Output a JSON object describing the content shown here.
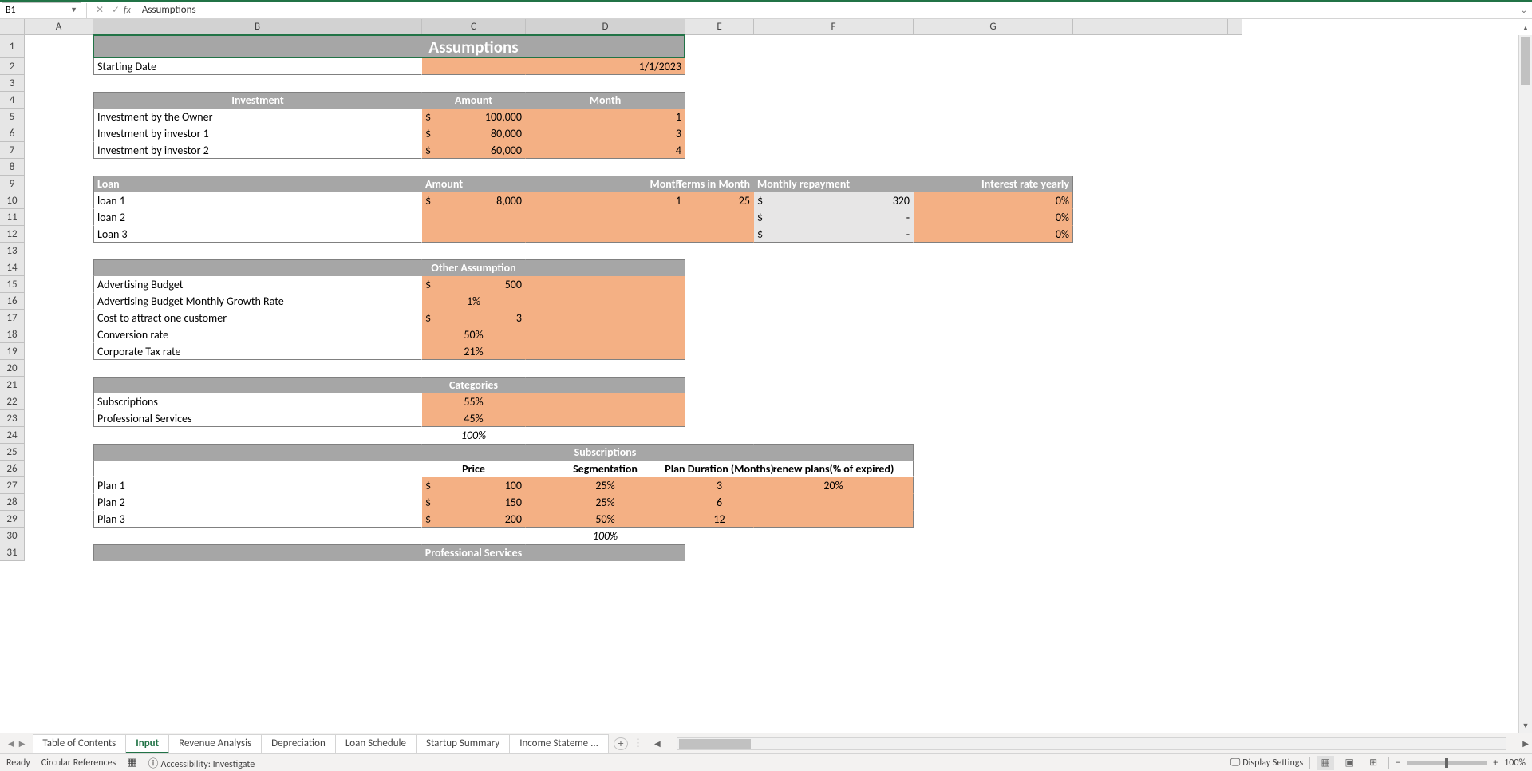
{
  "nameBox": "B1",
  "formulaBar": "Assumptions",
  "columns": [
    "A",
    "B",
    "C",
    "D",
    "E",
    "F",
    "G"
  ],
  "rows": [
    "1",
    "2",
    "3",
    "4",
    "5",
    "6",
    "7",
    "8",
    "9",
    "10",
    "11",
    "12",
    "13",
    "14",
    "15",
    "16",
    "17",
    "18",
    "19",
    "20",
    "21",
    "22",
    "23",
    "24",
    "25",
    "26",
    "27",
    "28",
    "29",
    "30",
    "31"
  ],
  "title": "Assumptions",
  "startingDate": {
    "label": "Starting Date",
    "value": "1/1/2023"
  },
  "investmentHeader": {
    "col1": "Investment",
    "col2": "Amount",
    "col3": "Month"
  },
  "investments": [
    {
      "label": "Investment by the Owner",
      "cur": "$",
      "amount": "100,000",
      "month": "1"
    },
    {
      "label": "Investment by investor 1",
      "cur": "$",
      "amount": "80,000",
      "month": "3"
    },
    {
      "label": "Investment by investor 2",
      "cur": "$",
      "amount": "60,000",
      "month": "4"
    }
  ],
  "loanHeader": {
    "col1": "Loan",
    "col2": "Amount",
    "col3": "Month",
    "col4": "Terms in Month",
    "col5": "Monthly repayment",
    "col6": "Interest rate yearly"
  },
  "loans": [
    {
      "label": "loan 1",
      "cur": "$",
      "amount": "8,000",
      "month": "1",
      "terms": "25",
      "repCur": "$",
      "repay": "320",
      "rate": "0%"
    },
    {
      "label": "loan 2",
      "cur": "",
      "amount": "",
      "month": "",
      "terms": "",
      "repCur": "$",
      "repay": "-",
      "rate": "0%"
    },
    {
      "label": "Loan 3",
      "cur": "",
      "amount": "",
      "month": "",
      "terms": "",
      "repCur": "$",
      "repay": "-",
      "rate": "0%"
    }
  ],
  "otherHeader": "Other Assumption",
  "other": [
    {
      "label": "Advertising Budget",
      "cur": "$",
      "val": "500",
      "right": true
    },
    {
      "label": "Advertising Budget Monthly Growth Rate",
      "cur": "",
      "val": "1%",
      "center": true
    },
    {
      "label": "Cost to attract one customer",
      "cur": "$",
      "val": "3",
      "right": true
    },
    {
      "label": "Conversion rate",
      "cur": "",
      "val": "50%",
      "center": true
    },
    {
      "label": "Corporate Tax rate",
      "cur": "",
      "val": "21%",
      "center": true
    }
  ],
  "catHeader": "Categories",
  "categories": [
    {
      "label": "Subscriptions",
      "val": "55%"
    },
    {
      "label": "Professional Services",
      "val": "45%"
    }
  ],
  "catTotal": "100%",
  "subsHeader": "Subscriptions",
  "subsCols": {
    "price": "Price",
    "seg": "Segmentation",
    "dur": "Plan Duration (Months)",
    "renew": "renew plans(% of expired)"
  },
  "plans": [
    {
      "label": "Plan 1",
      "cur": "$",
      "price": "100",
      "seg": "25%",
      "dur": "3",
      "renew": "20%"
    },
    {
      "label": "Plan 2",
      "cur": "$",
      "price": "150",
      "seg": "25%",
      "dur": "6",
      "renew": ""
    },
    {
      "label": "Plan 3",
      "cur": "$",
      "price": "200",
      "seg": "50%",
      "dur": "12",
      "renew": ""
    }
  ],
  "subsTotal": "100%",
  "profHeader": "Professional Services",
  "tabs": [
    "Table of Contents",
    "Input",
    "Revenue Analysis",
    "Depreciation",
    "Loan Schedule",
    "Startup Summary",
    "Income Stateme ..."
  ],
  "activeTab": "Input",
  "status": {
    "ready": "Ready",
    "circ": "Circular References",
    "acc": "Accessibility: Investigate",
    "display": "Display Settings",
    "zoom": "100%"
  }
}
